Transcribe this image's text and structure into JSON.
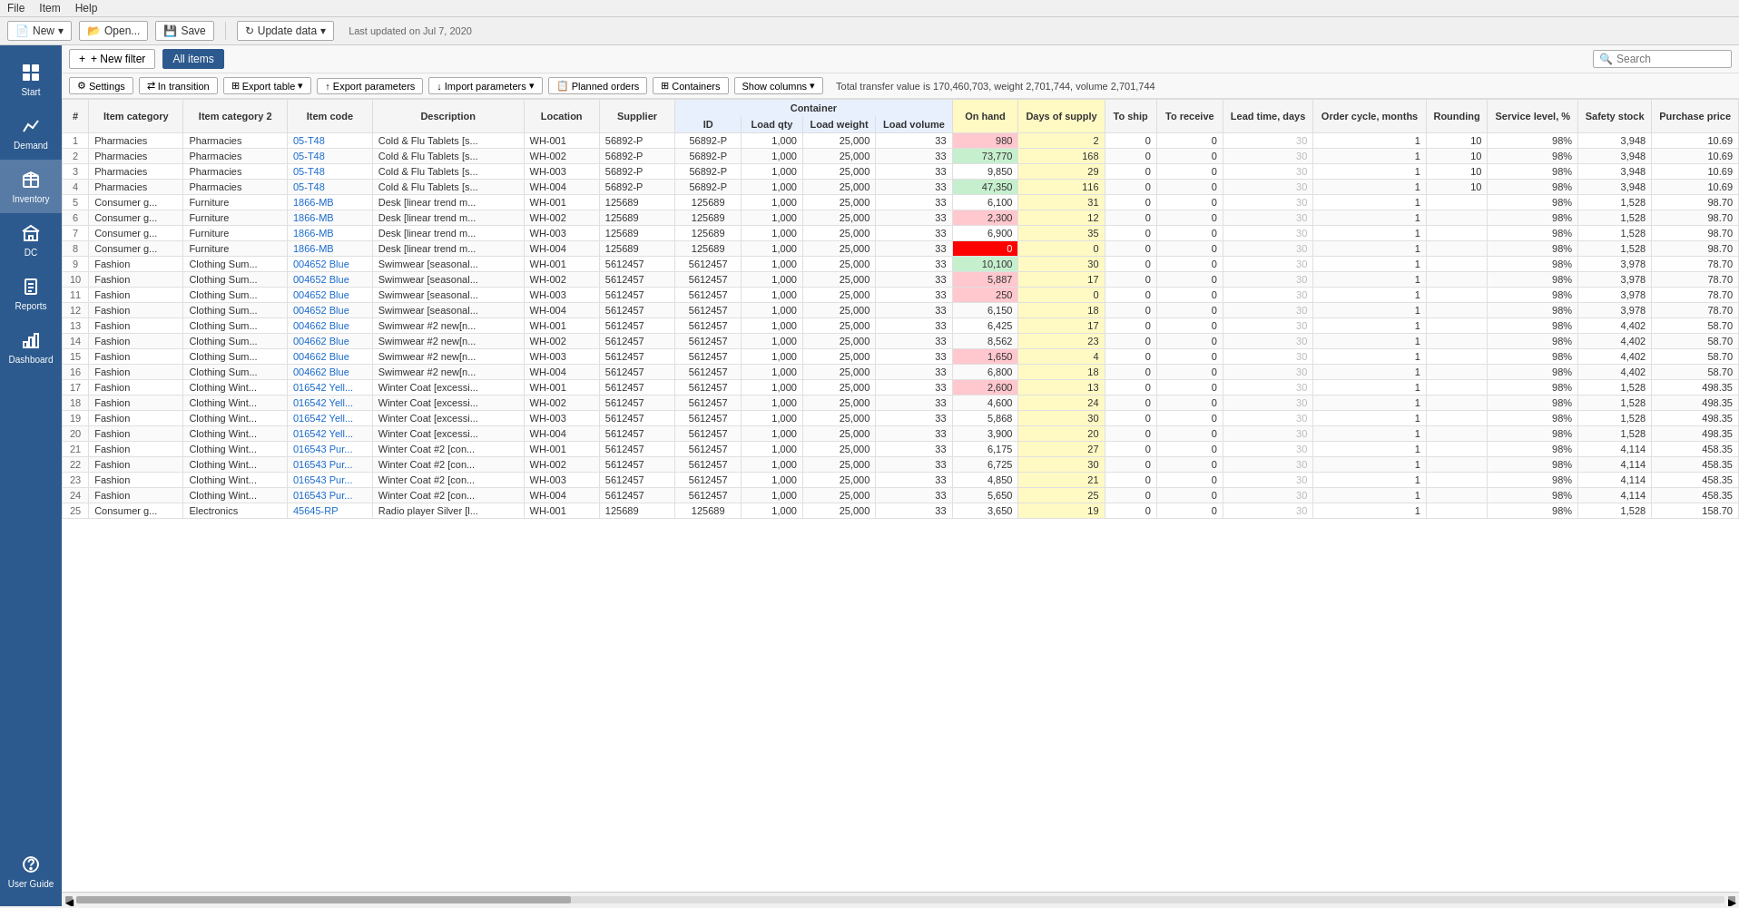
{
  "menuBar": {
    "items": [
      "File",
      "Item",
      "Help"
    ]
  },
  "toolbar": {
    "newBtn": "New",
    "openBtn": "Open...",
    "saveBtn": "Save",
    "updateBtn": "Update data",
    "lastUpdated": "Last updated on Jul 7, 2020"
  },
  "sidebar": {
    "items": [
      {
        "label": "Start",
        "icon": "grid"
      },
      {
        "label": "Demand",
        "icon": "chart-line"
      },
      {
        "label": "Inventory",
        "icon": "box"
      },
      {
        "label": "DC",
        "icon": "building"
      },
      {
        "label": "Reports",
        "icon": "document"
      },
      {
        "label": "Dashboard",
        "icon": "bar-chart"
      }
    ],
    "bottom": {
      "label": "User Guide",
      "icon": "question"
    }
  },
  "filterBar": {
    "newFilter": "+ New filter",
    "allItems": "All items"
  },
  "actionBar": {
    "settings": "Settings",
    "inTransition": "In transition",
    "exportTable": "Export table",
    "exportParams": "Export parameters",
    "importParams": "Import parameters",
    "plannedOrders": "Planned orders",
    "containers": "Containers",
    "showColumns": "Show columns",
    "totalInfo": "Total transfer value is 170,460,703, weight 2,701,744, volume 2,701,744"
  },
  "table": {
    "headers": {
      "row1": [
        {
          "label": "#",
          "rowspan": 2,
          "colspan": 1
        },
        {
          "label": "Item category",
          "rowspan": 2,
          "colspan": 1
        },
        {
          "label": "Item category 2",
          "rowspan": 2,
          "colspan": 1
        },
        {
          "label": "Item code",
          "rowspan": 2,
          "colspan": 1
        },
        {
          "label": "Description",
          "rowspan": 2,
          "colspan": 1
        },
        {
          "label": "Location",
          "rowspan": 2,
          "colspan": 1
        },
        {
          "label": "Supplier",
          "rowspan": 2,
          "colspan": 1
        },
        {
          "label": "Container",
          "rowspan": 1,
          "colspan": 4
        },
        {
          "label": "On hand",
          "rowspan": 2,
          "colspan": 1
        },
        {
          "label": "Days of supply",
          "rowspan": 2,
          "colspan": 1
        },
        {
          "label": "To ship",
          "rowspan": 2,
          "colspan": 1
        },
        {
          "label": "To receive",
          "rowspan": 2,
          "colspan": 1
        },
        {
          "label": "Lead time, days",
          "rowspan": 2,
          "colspan": 1
        },
        {
          "label": "Order cycle, months",
          "rowspan": 2,
          "colspan": 1
        },
        {
          "label": "Rounding",
          "rowspan": 2,
          "colspan": 1
        },
        {
          "label": "Service level, %",
          "rowspan": 2,
          "colspan": 1
        },
        {
          "label": "Safety stock",
          "rowspan": 2,
          "colspan": 1
        },
        {
          "label": "Purchase price",
          "rowspan": 2,
          "colspan": 1
        }
      ],
      "containerSub": [
        "ID",
        "Load qty",
        "Load weight",
        "Load volume"
      ]
    },
    "rows": [
      {
        "num": 1,
        "cat1": "Pharmacies",
        "cat2": "Pharmacies",
        "code": "05-T48",
        "desc": "Cold & Flu Tablets [s...",
        "loc": "WH-001",
        "sup": "56892-P",
        "cid": "56892-P",
        "lqty": 1000,
        "lwt": "25,000",
        "lvol": 33,
        "onhand": 980,
        "onhand_class": "onhand-pink",
        "dos": 2,
        "toship": 0,
        "toreceive": 0,
        "lt": 30,
        "oc": 1,
        "rounding": 10,
        "sl": "98%",
        "ss": 3948,
        "pp": "10.69"
      },
      {
        "num": 2,
        "cat1": "Pharmacies",
        "cat2": "Pharmacies",
        "code": "05-T48",
        "desc": "Cold & Flu Tablets [s...",
        "loc": "WH-002",
        "sup": "56892-P",
        "cid": "56892-P",
        "lqty": 1000,
        "lwt": "25,000",
        "lvol": 33,
        "onhand": 73770,
        "onhand_class": "onhand-green",
        "dos": 168,
        "toship": 0,
        "toreceive": 0,
        "lt": 30,
        "oc": 1,
        "rounding": 10,
        "sl": "98%",
        "ss": 3948,
        "pp": "10.69"
      },
      {
        "num": 3,
        "cat1": "Pharmacies",
        "cat2": "Pharmacies",
        "code": "05-T48",
        "desc": "Cold & Flu Tablets [s...",
        "loc": "WH-003",
        "sup": "56892-P",
        "cid": "56892-P",
        "lqty": 1000,
        "lwt": "25,000",
        "lvol": 33,
        "onhand": 9850,
        "onhand_class": "",
        "dos": 29,
        "toship": 0,
        "toreceive": 0,
        "lt": 30,
        "oc": 1,
        "rounding": 10,
        "sl": "98%",
        "ss": 3948,
        "pp": "10.69"
      },
      {
        "num": 4,
        "cat1": "Pharmacies",
        "cat2": "Pharmacies",
        "code": "05-T48",
        "desc": "Cold & Flu Tablets [s...",
        "loc": "WH-004",
        "sup": "56892-P",
        "cid": "56892-P",
        "lqty": 1000,
        "lwt": "25,000",
        "lvol": 33,
        "onhand": 47350,
        "onhand_class": "onhand-green",
        "dos": 116,
        "toship": 0,
        "toreceive": 0,
        "lt": 30,
        "oc": 1,
        "rounding": 10,
        "sl": "98%",
        "ss": 3948,
        "pp": "10.69"
      },
      {
        "num": 5,
        "cat1": "Consumer g...",
        "cat2": "Furniture",
        "code": "1866-MB",
        "desc": "Desk [linear trend m...",
        "loc": "WH-001",
        "sup": "125689",
        "cid": "125689",
        "lqty": 1000,
        "lwt": "25,000",
        "lvol": 33,
        "onhand": 6100,
        "onhand_class": "",
        "dos": 31,
        "toship": 0,
        "toreceive": 0,
        "lt": 30,
        "oc": 1,
        "rounding": "",
        "sl": "98%",
        "ss": 1528,
        "pp": "98.70"
      },
      {
        "num": 6,
        "cat1": "Consumer g...",
        "cat2": "Furniture",
        "code": "1866-MB",
        "desc": "Desk [linear trend m...",
        "loc": "WH-002",
        "sup": "125689",
        "cid": "125689",
        "lqty": 1000,
        "lwt": "25,000",
        "lvol": 33,
        "onhand": 2300,
        "onhand_class": "onhand-pink",
        "dos": 12,
        "toship": 0,
        "toreceive": 0,
        "lt": 30,
        "oc": 1,
        "rounding": "",
        "sl": "98%",
        "ss": 1528,
        "pp": "98.70"
      },
      {
        "num": 7,
        "cat1": "Consumer g...",
        "cat2": "Furniture",
        "code": "1866-MB",
        "desc": "Desk [linear trend m...",
        "loc": "WH-003",
        "sup": "125689",
        "cid": "125689",
        "lqty": 1000,
        "lwt": "25,000",
        "lvol": 33,
        "onhand": 6900,
        "onhand_class": "",
        "dos": 35,
        "toship": 0,
        "toreceive": 0,
        "lt": 30,
        "oc": 1,
        "rounding": "",
        "sl": "98%",
        "ss": 1528,
        "pp": "98.70"
      },
      {
        "num": 8,
        "cat1": "Consumer g...",
        "cat2": "Furniture",
        "code": "1866-MB",
        "desc": "Desk [linear trend m...",
        "loc": "WH-004",
        "sup": "125689",
        "cid": "125689",
        "lqty": 1000,
        "lwt": "25,000",
        "lvol": 33,
        "onhand": 0,
        "onhand_class": "onhand-red",
        "dos": 0,
        "toship": 0,
        "toreceive": 0,
        "lt": 30,
        "oc": 1,
        "rounding": "",
        "sl": "98%",
        "ss": 1528,
        "pp": "98.70"
      },
      {
        "num": 9,
        "cat1": "Fashion",
        "cat2": "Clothing Sum...",
        "code": "004652 Blue",
        "desc": "Swimwear [seasonal...",
        "loc": "WH-001",
        "sup": "5612457",
        "cid": "5612457",
        "lqty": 1000,
        "lwt": "25,000",
        "lvol": 33,
        "onhand": 10100,
        "onhand_class": "onhand-green",
        "dos": 30,
        "toship": 0,
        "toreceive": 0,
        "lt": 30,
        "oc": 1,
        "rounding": "",
        "sl": "98%",
        "ss": 3978,
        "pp": "78.70"
      },
      {
        "num": 10,
        "cat1": "Fashion",
        "cat2": "Clothing Sum...",
        "code": "004652 Blue",
        "desc": "Swimwear [seasonal...",
        "loc": "WH-002",
        "sup": "5612457",
        "cid": "5612457",
        "lqty": 1000,
        "lwt": "25,000",
        "lvol": 33,
        "onhand": 5887,
        "onhand_class": "onhand-pink",
        "dos": 17,
        "toship": 0,
        "toreceive": 0,
        "lt": 30,
        "oc": 1,
        "rounding": "",
        "sl": "98%",
        "ss": 3978,
        "pp": "78.70"
      },
      {
        "num": 11,
        "cat1": "Fashion",
        "cat2": "Clothing Sum...",
        "code": "004652 Blue",
        "desc": "Swimwear [seasonal...",
        "loc": "WH-003",
        "sup": "5612457",
        "cid": "5612457",
        "lqty": 1000,
        "lwt": "25,000",
        "lvol": 33,
        "onhand": 250,
        "onhand_class": "onhand-pink",
        "dos": 0,
        "toship": 0,
        "toreceive": 0,
        "lt": 30,
        "oc": 1,
        "rounding": "",
        "sl": "98%",
        "ss": 3978,
        "pp": "78.70"
      },
      {
        "num": 12,
        "cat1": "Fashion",
        "cat2": "Clothing Sum...",
        "code": "004652 Blue",
        "desc": "Swimwear [seasonal...",
        "loc": "WH-004",
        "sup": "5612457",
        "cid": "5612457",
        "lqty": 1000,
        "lwt": "25,000",
        "lvol": 33,
        "onhand": 6150,
        "onhand_class": "",
        "dos": 18,
        "toship": 0,
        "toreceive": 0,
        "lt": 30,
        "oc": 1,
        "rounding": "",
        "sl": "98%",
        "ss": 3978,
        "pp": "78.70"
      },
      {
        "num": 13,
        "cat1": "Fashion",
        "cat2": "Clothing Sum...",
        "code": "004662 Blue",
        "desc": "Swimwear #2 new[n...",
        "loc": "WH-001",
        "sup": "5612457",
        "cid": "5612457",
        "lqty": 1000,
        "lwt": "25,000",
        "lvol": 33,
        "onhand": 6425,
        "onhand_class": "",
        "dos": 17,
        "toship": 0,
        "toreceive": 0,
        "lt": 30,
        "oc": 1,
        "rounding": "",
        "sl": "98%",
        "ss": 4402,
        "pp": "58.70"
      },
      {
        "num": 14,
        "cat1": "Fashion",
        "cat2": "Clothing Sum...",
        "code": "004662 Blue",
        "desc": "Swimwear #2 new[n...",
        "loc": "WH-002",
        "sup": "5612457",
        "cid": "5612457",
        "lqty": 1000,
        "lwt": "25,000",
        "lvol": 33,
        "onhand": 8562,
        "onhand_class": "",
        "dos": 23,
        "toship": 0,
        "toreceive": 0,
        "lt": 30,
        "oc": 1,
        "rounding": "",
        "sl": "98%",
        "ss": 4402,
        "pp": "58.70"
      },
      {
        "num": 15,
        "cat1": "Fashion",
        "cat2": "Clothing Sum...",
        "code": "004662 Blue",
        "desc": "Swimwear #2 new[n...",
        "loc": "WH-003",
        "sup": "5612457",
        "cid": "5612457",
        "lqty": 1000,
        "lwt": "25,000",
        "lvol": 33,
        "onhand": 1650,
        "onhand_class": "onhand-pink",
        "dos": 4,
        "toship": 0,
        "toreceive": 0,
        "lt": 30,
        "oc": 1,
        "rounding": "",
        "sl": "98%",
        "ss": 4402,
        "pp": "58.70"
      },
      {
        "num": 16,
        "cat1": "Fashion",
        "cat2": "Clothing Sum...",
        "code": "004662 Blue",
        "desc": "Swimwear #2 new[n...",
        "loc": "WH-004",
        "sup": "5612457",
        "cid": "5612457",
        "lqty": 1000,
        "lwt": "25,000",
        "lvol": 33,
        "onhand": 6800,
        "onhand_class": "",
        "dos": 18,
        "toship": 0,
        "toreceive": 0,
        "lt": 30,
        "oc": 1,
        "rounding": "",
        "sl": "98%",
        "ss": 4402,
        "pp": "58.70"
      },
      {
        "num": 17,
        "cat1": "Fashion",
        "cat2": "Clothing Wint...",
        "code": "016542 Yell...",
        "desc": "Winter Coat [excessi...",
        "loc": "WH-001",
        "sup": "5612457",
        "cid": "5612457",
        "lqty": 1000,
        "lwt": "25,000",
        "lvol": 33,
        "onhand": 2600,
        "onhand_class": "onhand-pink",
        "dos": 13,
        "toship": 0,
        "toreceive": 0,
        "lt": 30,
        "oc": 1,
        "rounding": "",
        "sl": "98%",
        "ss": 1528,
        "pp": "498.35"
      },
      {
        "num": 18,
        "cat1": "Fashion",
        "cat2": "Clothing Wint...",
        "code": "016542 Yell...",
        "desc": "Winter Coat [excessi...",
        "loc": "WH-002",
        "sup": "5612457",
        "cid": "5612457",
        "lqty": 1000,
        "lwt": "25,000",
        "lvol": 33,
        "onhand": 4600,
        "onhand_class": "",
        "dos": 24,
        "toship": 0,
        "toreceive": 0,
        "lt": 30,
        "oc": 1,
        "rounding": "",
        "sl": "98%",
        "ss": 1528,
        "pp": "498.35"
      },
      {
        "num": 19,
        "cat1": "Fashion",
        "cat2": "Clothing Wint...",
        "code": "016542 Yell...",
        "desc": "Winter Coat [excessi...",
        "loc": "WH-003",
        "sup": "5612457",
        "cid": "5612457",
        "lqty": 1000,
        "lwt": "25,000",
        "lvol": 33,
        "onhand": 5868,
        "onhand_class": "",
        "dos": 30,
        "toship": 0,
        "toreceive": 0,
        "lt": 30,
        "oc": 1,
        "rounding": "",
        "sl": "98%",
        "ss": 1528,
        "pp": "498.35"
      },
      {
        "num": 20,
        "cat1": "Fashion",
        "cat2": "Clothing Wint...",
        "code": "016542 Yell...",
        "desc": "Winter Coat [excessi...",
        "loc": "WH-004",
        "sup": "5612457",
        "cid": "5612457",
        "lqty": 1000,
        "lwt": "25,000",
        "lvol": 33,
        "onhand": 3900,
        "onhand_class": "",
        "dos": 20,
        "toship": 0,
        "toreceive": 0,
        "lt": 30,
        "oc": 1,
        "rounding": "",
        "sl": "98%",
        "ss": 1528,
        "pp": "498.35"
      },
      {
        "num": 21,
        "cat1": "Fashion",
        "cat2": "Clothing Wint...",
        "code": "016543 Pur...",
        "desc": "Winter Coat #2 [con...",
        "loc": "WH-001",
        "sup": "5612457",
        "cid": "5612457",
        "lqty": 1000,
        "lwt": "25,000",
        "lvol": 33,
        "onhand": 6175,
        "onhand_class": "",
        "dos": 27,
        "toship": 0,
        "toreceive": 0,
        "lt": 30,
        "oc": 1,
        "rounding": "",
        "sl": "98%",
        "ss": 4114,
        "pp": "458.35"
      },
      {
        "num": 22,
        "cat1": "Fashion",
        "cat2": "Clothing Wint...",
        "code": "016543 Pur...",
        "desc": "Winter Coat #2 [con...",
        "loc": "WH-002",
        "sup": "5612457",
        "cid": "5612457",
        "lqty": 1000,
        "lwt": "25,000",
        "lvol": 33,
        "onhand": 6725,
        "onhand_class": "",
        "dos": 30,
        "toship": 0,
        "toreceive": 0,
        "lt": 30,
        "oc": 1,
        "rounding": "",
        "sl": "98%",
        "ss": 4114,
        "pp": "458.35"
      },
      {
        "num": 23,
        "cat1": "Fashion",
        "cat2": "Clothing Wint...",
        "code": "016543 Pur...",
        "desc": "Winter Coat #2 [con...",
        "loc": "WH-003",
        "sup": "5612457",
        "cid": "5612457",
        "lqty": 1000,
        "lwt": "25,000",
        "lvol": 33,
        "onhand": 4850,
        "onhand_class": "",
        "dos": 21,
        "toship": 0,
        "toreceive": 0,
        "lt": 30,
        "oc": 1,
        "rounding": "",
        "sl": "98%",
        "ss": 4114,
        "pp": "458.35"
      },
      {
        "num": 24,
        "cat1": "Fashion",
        "cat2": "Clothing Wint...",
        "code": "016543 Pur...",
        "desc": "Winter Coat #2 [con...",
        "loc": "WH-004",
        "sup": "5612457",
        "cid": "5612457",
        "lqty": 1000,
        "lwt": "25,000",
        "lvol": 33,
        "onhand": 5650,
        "onhand_class": "",
        "dos": 25,
        "toship": 0,
        "toreceive": 0,
        "lt": 30,
        "oc": 1,
        "rounding": "",
        "sl": "98%",
        "ss": 4114,
        "pp": "458.35"
      },
      {
        "num": 25,
        "cat1": "Consumer g...",
        "cat2": "Electronics",
        "code": "45645-RP",
        "desc": "Radio player Silver [l...",
        "loc": "WH-001",
        "sup": "125689",
        "cid": "125689",
        "lqty": 1000,
        "lwt": "25,000",
        "lvol": 33,
        "onhand": 3650,
        "onhand_class": "",
        "dos": 19,
        "toship": 0,
        "toreceive": 0,
        "lt": 30,
        "oc": 1,
        "rounding": "",
        "sl": "98%",
        "ss": 1528,
        "pp": "158.70"
      }
    ]
  }
}
